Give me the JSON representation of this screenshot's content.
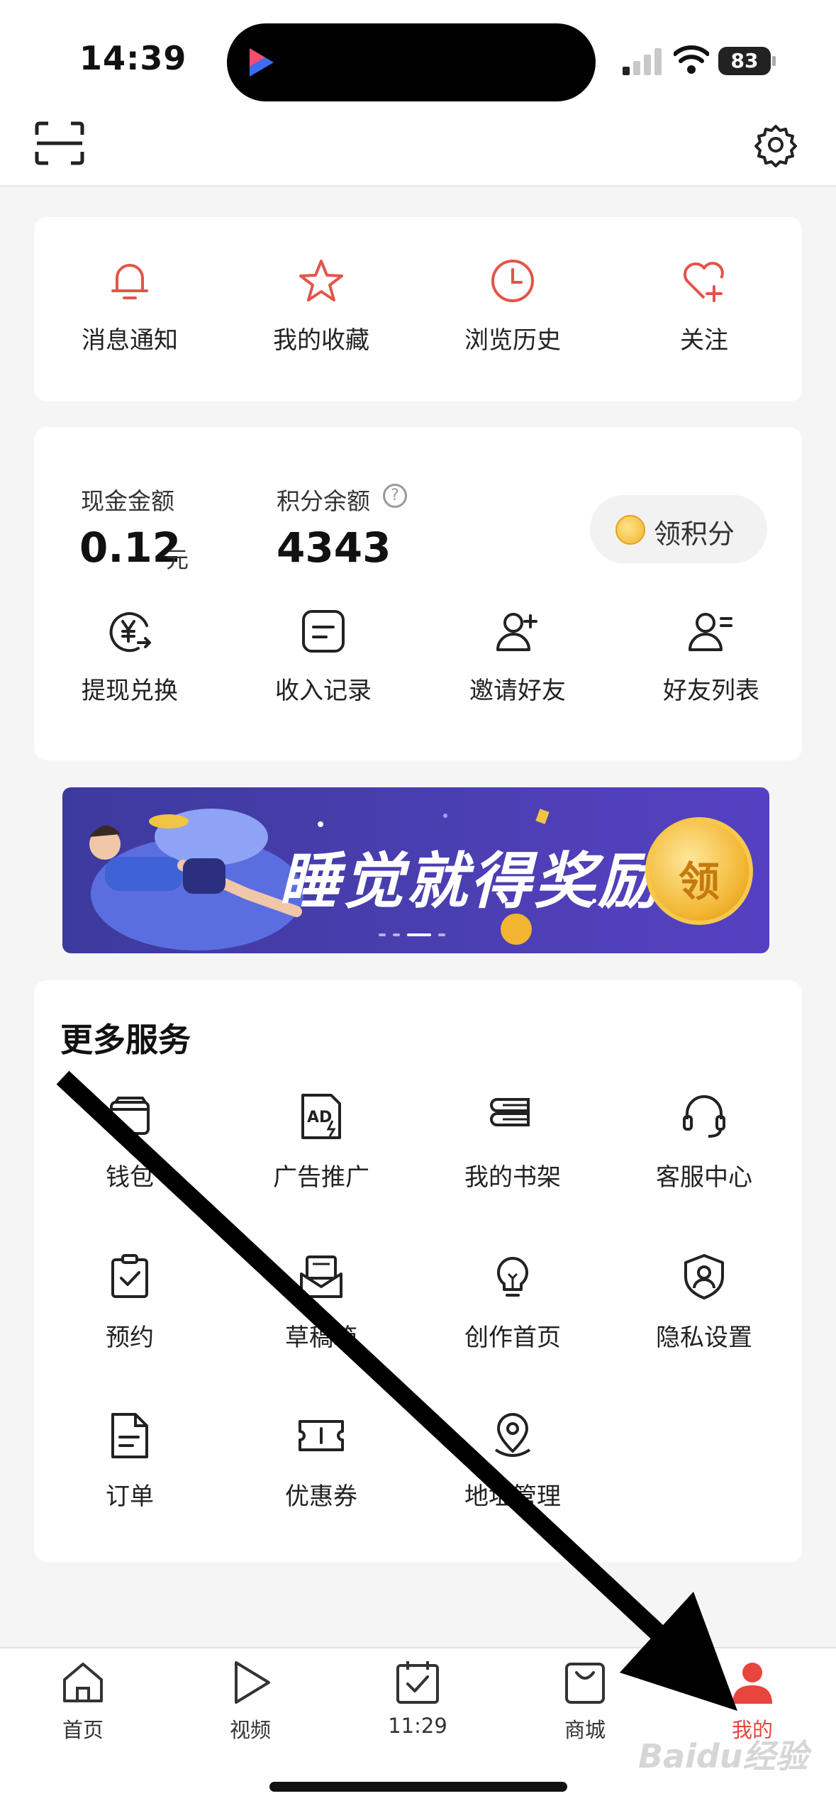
{
  "status_bar": {
    "time": "14:39",
    "battery": "83"
  },
  "quick_links": [
    {
      "label": "消息通知",
      "icon": "bell-icon"
    },
    {
      "label": "我的收藏",
      "icon": "star-icon"
    },
    {
      "label": "浏览历史",
      "icon": "clock-icon"
    },
    {
      "label": "关注",
      "icon": "heart-plus-icon"
    }
  ],
  "wallet": {
    "cash_label": "现金金额",
    "cash_value": "0.12",
    "cash_unit": "元",
    "points_label": "积分余额",
    "points_value": "4343",
    "help_glyph": "?",
    "claim_label": "领积分",
    "actions": [
      {
        "label": "提现兑换",
        "icon": "yuan-exchange-icon"
      },
      {
        "label": "收入记录",
        "icon": "record-icon"
      },
      {
        "label": "邀请好友",
        "icon": "invite-friend-icon"
      },
      {
        "label": "好友列表",
        "icon": "friend-list-icon"
      }
    ]
  },
  "banner": {
    "title": "睡觉就得奖励",
    "coin_text": "领"
  },
  "more_services": {
    "title": "更多服务",
    "items": [
      {
        "label": "钱包",
        "icon": "wallet-icon"
      },
      {
        "label": "广告推广",
        "icon": "ad-icon"
      },
      {
        "label": "我的书架",
        "icon": "bookshelf-icon"
      },
      {
        "label": "客服中心",
        "icon": "headset-icon"
      },
      {
        "label": "预约",
        "icon": "clipboard-check-icon"
      },
      {
        "label": "草稿箱",
        "icon": "draft-box-icon"
      },
      {
        "label": "创作首页",
        "icon": "lightbulb-icon"
      },
      {
        "label": "隐私设置",
        "icon": "privacy-shield-icon"
      },
      {
        "label": "订单",
        "icon": "order-icon"
      },
      {
        "label": "优惠券",
        "icon": "coupon-icon"
      },
      {
        "label": "地址管理",
        "icon": "location-pin-icon"
      }
    ]
  },
  "bottom_nav": [
    {
      "label": "首页",
      "icon": "home-icon"
    },
    {
      "label": "视频",
      "icon": "play-icon"
    },
    {
      "label": "11:29",
      "icon": "calendar-check-icon"
    },
    {
      "label": "商城",
      "icon": "shopping-bag-icon"
    },
    {
      "label": "我的",
      "icon": "person-icon",
      "active": true
    }
  ],
  "watermark": "Baidu经验",
  "colors": {
    "accent": "#e8453c",
    "banner_bg": "#4a3fb1",
    "page_bg": "#f5f5f5"
  }
}
